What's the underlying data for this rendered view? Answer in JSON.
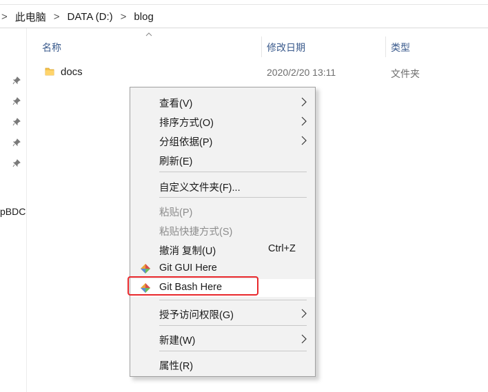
{
  "address_bar": {
    "crumbs": [
      "此电脑",
      "DATA (D:)",
      "blog"
    ],
    "separator": ">"
  },
  "nav_pane": {
    "pinned_count": 5,
    "truncated_label": "pBDC"
  },
  "columns": {
    "name": "名称",
    "date_modified": "修改日期",
    "type": "类型"
  },
  "files": [
    {
      "name": "docs",
      "date": "2020/2/20 13:11",
      "type": "文件夹",
      "icon": "folder-icon"
    }
  ],
  "context_menu": {
    "view": "查看(V)",
    "sort_by": "排序方式(O)",
    "group_by": "分组依据(P)",
    "refresh": "刷新(E)",
    "customize_folder": "自定义文件夹(F)...",
    "paste": "粘贴(P)",
    "paste_shortcut": "粘贴快捷方式(S)",
    "undo_copy": "撤消 复制(U)",
    "undo_copy_shortcut": "Ctrl+Z",
    "git_gui": "Git GUI Here",
    "git_bash": "Git Bash Here",
    "give_access": "授予访问权限(G)",
    "new": "新建(W)",
    "properties": "属性(R)"
  },
  "colors": {
    "highlight_box": "#e8262a",
    "column_header_text": "#3a5a8c",
    "folder": "#f5c34b"
  }
}
